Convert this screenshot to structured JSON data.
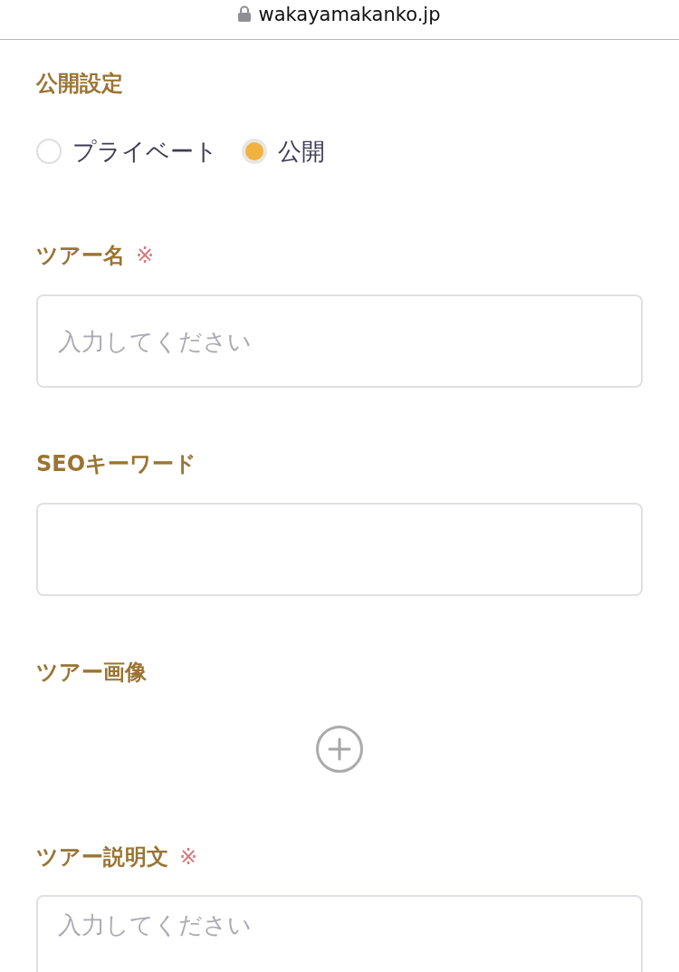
{
  "address_bar": {
    "url": "wakayamakanko.jp"
  },
  "sections": [
    {
      "kind": "radio",
      "label": "公開設定",
      "options": [
        {
          "label": "プライベート",
          "selected": false
        },
        {
          "label": "公開",
          "selected": true
        }
      ]
    },
    {
      "kind": "text",
      "label": "ツアー名",
      "required_mark": "※",
      "placeholder": "入力してください"
    },
    {
      "kind": "text",
      "label": "SEOキーワード"
    },
    {
      "kind": "image",
      "label": "ツアー画像"
    },
    {
      "kind": "textarea",
      "label": "ツアー説明文",
      "required_mark": "※",
      "placeholder": "入力してください"
    }
  ]
}
